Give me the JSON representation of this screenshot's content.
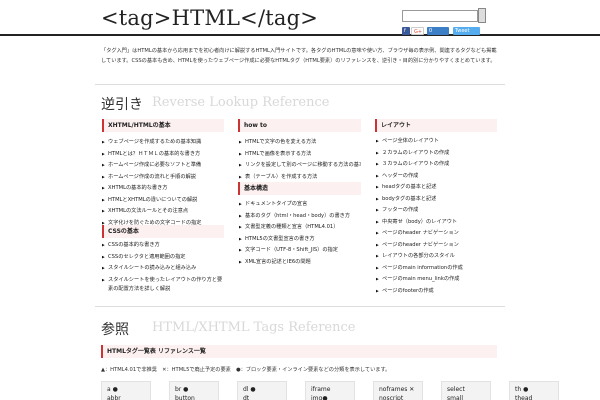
{
  "header": {
    "logo": "<tag>HTML</tag>",
    "search_placeholder": "",
    "social": {
      "facebook": "f",
      "googleplus": "G+",
      "count": "0",
      "twitter": "Tweet"
    }
  },
  "intro": "「タグ入門」はHTMLの基本から応用までを初心者向けに解説するHTML入門サイトです。各タグのHTMLの意味や使い方、ブラウザ毎の表示例、関連するタグなども掲載しています。CSSの基本も含め、HTMLを使ったウェブページ作成に必要なHTMLタグ（HTML要素）のリファレンスを、逆引き・目的別に分かりやすくまとめています。",
  "reverse": {
    "title": "逆引き",
    "subtitle": "Reverse Lookup Reference",
    "col1": {
      "head": "XHTML/HTMLの基本",
      "items": [
        "ウェブページを作成するための基本知識",
        "HTMLとは？ＨＴＭＬの基本的な書き方",
        "ホームページ作成に必要なソフトと準備",
        "ホームページ作成の流れと手順の解説",
        "XHTMLの基本的な書き方",
        "HTMLとXHTMLの違いについての解説",
        "XHTMLの文法ルールとその注意点",
        "文字化けを防ぐための文字コードの指定"
      ]
    },
    "col1b": {
      "head": "CSSの基本",
      "items": [
        "CSSの基本的な書き方",
        "CSSのセレクタと適用範囲の指定",
        "スタイルシートの読み込みと組み込み",
        "スタイルシートを使ったレイアウトの作り方と要素の配置方法を詳しく解説"
      ]
    },
    "col2": {
      "head": "how to",
      "items": [
        "HTMLで文字の色を変える方法",
        "HTMLで画像を表示する方法",
        "リンクを設定して別のページに移動する方法の基本",
        "表（テーブル）を作成する方法"
      ]
    },
    "col2b": {
      "head": "基本構造",
      "items": [
        "ドキュメントタイプの宣言",
        "基本のタグ（html・head・body）の書き方",
        "文書型定義の種類と宣言（HTML4.01）",
        "HTML5の文書型宣言の書き方",
        "文字コード（UTF-8・Shift_JIS）の指定",
        "XML宣言の記述とIE6の問題"
      ]
    },
    "col3": {
      "head": "レイアウト",
      "items": [
        "ページ全体のレイアウト",
        "２カラムのレイアウトの作成",
        "３カラムのレイアウトの作成",
        "ヘッダーの作成",
        "headタグの基本と記述",
        "bodyタグの基本と記述",
        "フッターの作成",
        "中央寄せ（body）のレイアウト",
        "ページのheader ナビゲーション",
        "ページのheader ナビゲーション",
        "レイアウトの各部分のスタイル",
        "ページのmain informationの作成",
        "ページのmain menu_linkの作成",
        "ページのfooterの作成"
      ]
    }
  },
  "reference": {
    "title": "参照",
    "subtitle": "HTML/XHTML Tags Reference",
    "head": "HTMLタグ一覧表 リファレンス一覧",
    "legend": "▲：HTML4.01で非推奨　✕：HTML5で廃止予定の要素　●：ブロック要素・インライン要素などの分類を表示しています。",
    "tags": [
      {
        "line1": "a",
        "mark": "●",
        "line2": "abbr"
      },
      {
        "line1": "br",
        "mark": "●",
        "line2": "button"
      },
      {
        "line1": "dl",
        "mark": "●",
        "line2": "dt"
      },
      {
        "line1": "iframe",
        "mark": "",
        "line2": "img●"
      },
      {
        "line1": "noframes",
        "mark": "✕",
        "line2": "noscript"
      },
      {
        "line1": "select",
        "mark": "",
        "line2": "small"
      },
      {
        "line1": "th",
        "mark": "●",
        "line2": "thead"
      }
    ]
  }
}
